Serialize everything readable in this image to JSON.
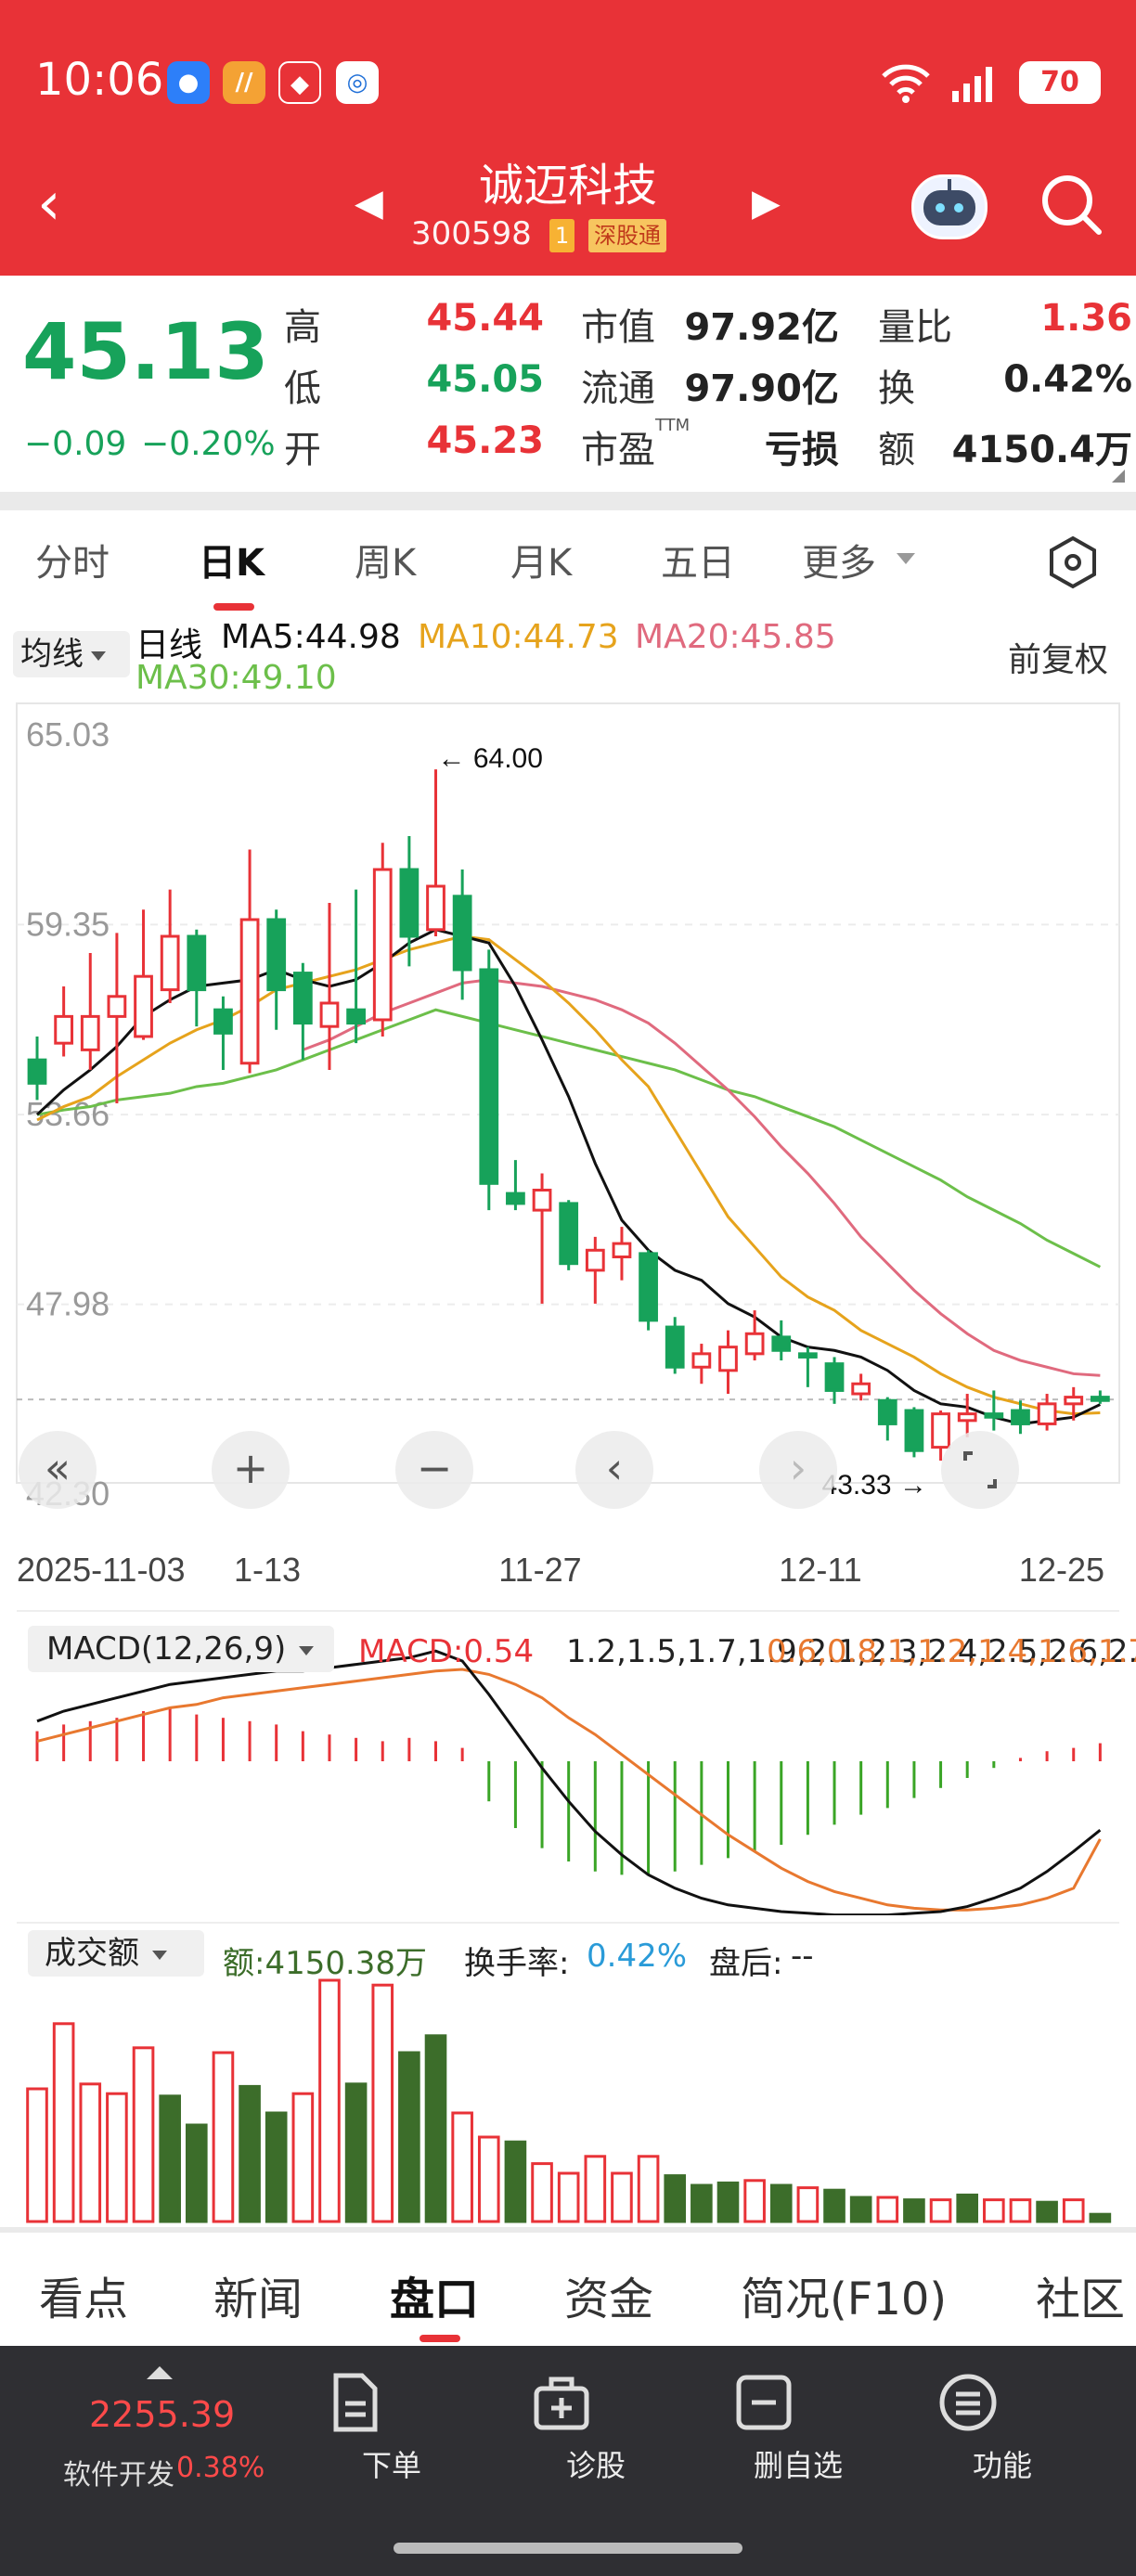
{
  "status": {
    "time": "10:06",
    "battery": "70"
  },
  "nav": {
    "title": "诚迈科技",
    "code": "300598",
    "tag1": "1",
    "tag2": "深股通"
  },
  "quote": {
    "price": "45.13",
    "change": "−0.09",
    "change_pct": "−0.20%",
    "high_label": "高",
    "high": "45.44",
    "low_label": "低",
    "low": "45.05",
    "open_label": "开",
    "open": "45.23",
    "mcap_label": "市值",
    "mcap": "97.92亿",
    "float_label": "流通",
    "float": "97.90亿",
    "pe_label": "市盈",
    "pe_sup": "TTM",
    "pe": "亏损",
    "vr_label": "量比",
    "vr": "1.36",
    "turn_label": "换",
    "turn": "0.42%",
    "amt_label": "额",
    "amt": "4150.4万"
  },
  "tabs": [
    "分时",
    "日K",
    "周K",
    "月K",
    "五日",
    "更多"
  ],
  "ma": {
    "selector": "均线",
    "line": "日线",
    "ma5": "MA5:44.98",
    "ma10": "MA10:44.73",
    "ma20": "MA20:45.85",
    "ma30": "MA30:49.10",
    "adjust": "前复权"
  },
  "colors": {
    "red": "#e83237",
    "green": "#17a25a",
    "ma5": "#111111",
    "ma10": "#e6a31c",
    "ma20": "#e06a7e",
    "ma30": "#6cbf4a",
    "vol_green": "#3c6d2a",
    "macd_green": "#3aa526"
  },
  "chart_data": {
    "type": "candlestick",
    "y_ticks": [
      "65.03",
      "59.35",
      "53.66",
      "47.98",
      "42.30"
    ],
    "ylim": [
      42.3,
      65.03
    ],
    "x_labels": [
      "2025-11-03",
      "1-13",
      "11-27",
      "12-11",
      "12-25"
    ],
    "annotations": {
      "high": "64.00",
      "low": "43.33"
    },
    "candles": [
      [
        55.3,
        54.6,
        56.0,
        54.1
      ],
      [
        55.8,
        56.6,
        57.5,
        55.4
      ],
      [
        55.6,
        56.6,
        58.5,
        55.0
      ],
      [
        56.6,
        57.2,
        59.1,
        54.0
      ],
      [
        56.0,
        57.8,
        59.8,
        55.9
      ],
      [
        57.4,
        59.0,
        60.4,
        57.0
      ],
      [
        59.0,
        57.4,
        59.2,
        56.3
      ],
      [
        56.8,
        56.1,
        57.2,
        55.0
      ],
      [
        55.2,
        59.5,
        61.6,
        54.9
      ],
      [
        59.5,
        57.4,
        59.8,
        56.2
      ],
      [
        57.9,
        56.4,
        58.2,
        55.3
      ],
      [
        56.3,
        57.0,
        60.0,
        55.0
      ],
      [
        56.8,
        56.4,
        60.4,
        55.8
      ],
      [
        56.5,
        61.0,
        61.8,
        56.0
      ],
      [
        61.0,
        59.0,
        62.0,
        58.1
      ],
      [
        59.2,
        60.5,
        64.0,
        59.0
      ],
      [
        60.2,
        58.0,
        61.0,
        57.1
      ],
      [
        58.0,
        51.6,
        58.6,
        50.8
      ],
      [
        51.3,
        51.0,
        52.3,
        50.8
      ],
      [
        50.8,
        51.4,
        51.9,
        48.0
      ],
      [
        51.0,
        49.2,
        51.1,
        49.0
      ],
      [
        49.0,
        49.6,
        50.0,
        48.0
      ],
      [
        49.4,
        49.8,
        50.3,
        48.7
      ],
      [
        49.5,
        47.5,
        49.6,
        47.2
      ],
      [
        47.3,
        46.1,
        47.6,
        45.9
      ],
      [
        46.1,
        46.5,
        46.8,
        45.6
      ],
      [
        46.0,
        46.7,
        47.2,
        45.3
      ],
      [
        46.5,
        47.1,
        47.8,
        46.3
      ],
      [
        47.0,
        46.6,
        47.5,
        46.3
      ],
      [
        46.5,
        46.4,
        46.7,
        45.5
      ],
      [
        46.2,
        45.4,
        46.4,
        45.0
      ],
      [
        45.3,
        45.6,
        45.9,
        45.1
      ],
      [
        45.1,
        44.4,
        45.2,
        43.9
      ],
      [
        44.8,
        43.6,
        44.9,
        43.4
      ],
      [
        43.7,
        44.7,
        44.8,
        43.3
      ],
      [
        44.5,
        44.7,
        45.3,
        44.0
      ],
      [
        44.7,
        44.6,
        45.4,
        44.2
      ],
      [
        44.8,
        44.4,
        45.1,
        44.1
      ],
      [
        44.4,
        45.0,
        45.3,
        44.2
      ],
      [
        45.0,
        45.2,
        45.5,
        44.5
      ],
      [
        45.2,
        45.1,
        45.4,
        45.0
      ]
    ],
    "ma5": [
      53.66,
      54.4,
      55.0,
      55.7,
      56.6,
      57.1,
      57.5,
      57.6,
      57.7,
      58.0,
      57.7,
      57.5,
      57.7,
      58.2,
      58.8,
      59.2,
      59.0,
      58.8,
      57.5,
      55.9,
      54.2,
      52.2,
      50.5,
      49.6,
      49.0,
      48.7,
      48.0,
      47.6,
      47.0,
      46.7,
      46.6,
      46.4,
      46.0,
      45.4,
      45.0,
      44.9,
      44.6,
      44.4,
      44.5,
      44.6,
      44.98
    ],
    "ma10": [
      53.5,
      53.9,
      54.2,
      54.8,
      55.3,
      55.8,
      56.2,
      56.5,
      56.9,
      57.4,
      57.6,
      57.8,
      58.0,
      58.3,
      58.6,
      58.8,
      59.0,
      58.9,
      58.3,
      57.7,
      57.0,
      56.2,
      55.3,
      54.5,
      53.2,
      51.9,
      50.6,
      49.7,
      48.8,
      48.2,
      47.8,
      47.2,
      46.8,
      46.4,
      45.9,
      45.5,
      45.2,
      45.0,
      44.8,
      44.7,
      44.73
    ],
    "ma20": [
      null,
      null,
      null,
      null,
      null,
      null,
      null,
      null,
      null,
      null,
      55.6,
      55.9,
      56.3,
      56.7,
      57.0,
      57.3,
      57.6,
      57.7,
      57.6,
      57.5,
      57.3,
      57.1,
      56.8,
      56.4,
      55.8,
      55.1,
      54.4,
      53.6,
      52.7,
      51.9,
      51.0,
      50.0,
      49.2,
      48.4,
      47.7,
      47.1,
      46.6,
      46.3,
      46.1,
      45.9,
      45.85
    ],
    "ma30": [
      53.66,
      53.8,
      53.9,
      54.1,
      54.2,
      54.3,
      54.5,
      54.6,
      54.8,
      55.0,
      55.3,
      55.6,
      55.9,
      56.2,
      56.5,
      56.8,
      56.6,
      56.4,
      56.2,
      56.0,
      55.8,
      55.6,
      55.4,
      55.2,
      55.0,
      54.7,
      54.4,
      54.2,
      53.9,
      53.6,
      53.3,
      52.9,
      52.5,
      52.1,
      51.7,
      51.2,
      50.8,
      50.4,
      49.9,
      49.5,
      49.1
    ]
  },
  "macd": {
    "selector": "MACD(12,26,9)",
    "macd": "MACD:0.54",
    "diff": [
      1.2,
      1.5,
      1.7,
      1.9,
      2.1,
      2.3,
      2.4,
      2.5,
      2.6,
      2.7,
      2.7,
      2.8,
      2.9,
      3.0,
      3.1,
      3.3,
      3.0,
      2.0,
      0.9,
      -0.2,
      -1.2,
      -2.1,
      -2.8,
      -3.4,
      -3.8,
      -4.1,
      -4.3,
      -4.4,
      -4.5,
      -4.55,
      -4.6,
      -4.6,
      -4.6,
      -4.55,
      -4.5,
      -4.35,
      -4.1,
      -3.8,
      -3.3,
      -2.7,
      -2.06
    ],
    "dea": [
      0.6,
      0.8,
      1.0,
      1.2,
      1.4,
      1.6,
      1.7,
      1.9,
      2.0,
      2.1,
      2.2,
      2.3,
      2.4,
      2.5,
      2.6,
      2.7,
      2.75,
      2.6,
      2.3,
      1.9,
      1.3,
      0.8,
      0.2,
      -0.4,
      -1.0,
      -1.6,
      -2.2,
      -2.7,
      -3.2,
      -3.6,
      -3.9,
      -4.1,
      -4.3,
      -4.4,
      -4.45,
      -4.45,
      -4.4,
      -4.3,
      -4.1,
      -3.8,
      -2.33
    ],
    "hist": [
      0.9,
      1.1,
      1.2,
      1.3,
      1.5,
      1.6,
      1.4,
      1.3,
      1.2,
      1.1,
      0.9,
      0.8,
      0.7,
      0.6,
      0.7,
      0.6,
      0.4,
      -1.2,
      -2.0,
      -2.6,
      -3.0,
      -3.3,
      -3.4,
      -3.4,
      -3.3,
      -3.1,
      -2.9,
      -2.7,
      -2.5,
      -2.2,
      -1.9,
      -1.6,
      -1.4,
      -1.1,
      -0.8,
      -0.5,
      -0.2,
      0.1,
      0.3,
      0.4,
      0.54
    ]
  },
  "volume": {
    "selector": "成交额",
    "amount": "额:4150.38万",
    "turnover_label": "换手率:",
    "turnover": "0.42%",
    "after_label": "盘后:",
    "after": "--",
    "bars": [
      0.55,
      0.82,
      0.57,
      0.53,
      0.72,
      0.52,
      0.4,
      0.7,
      0.56,
      0.45,
      0.53,
      1.0,
      0.57,
      0.98,
      0.7,
      0.77,
      0.45,
      0.35,
      0.33,
      0.24,
      0.2,
      0.27,
      0.2,
      0.27,
      0.19,
      0.15,
      0.16,
      0.17,
      0.15,
      0.14,
      0.13,
      0.1,
      0.1,
      0.09,
      0.09,
      0.11,
      0.09,
      0.09,
      0.08,
      0.09,
      0.03
    ],
    "up": [
      1,
      1,
      1,
      1,
      1,
      0,
      0,
      1,
      0,
      0,
      1,
      1,
      0,
      1,
      0,
      0,
      1,
      1,
      0,
      1,
      1,
      1,
      1,
      1,
      0,
      0,
      0,
      1,
      0,
      1,
      0,
      0,
      1,
      0,
      1,
      0,
      1,
      1,
      0,
      1,
      0
    ]
  },
  "bottom_tabs": [
    "看点",
    "新闻",
    "盘口",
    "资金",
    "简况(F10)",
    "社区"
  ],
  "footer": {
    "index": "2255.39",
    "sector": "软件开发",
    "sector_pct": "0.38%",
    "items": [
      "下单",
      "诊股",
      "删自选",
      "功能"
    ]
  }
}
